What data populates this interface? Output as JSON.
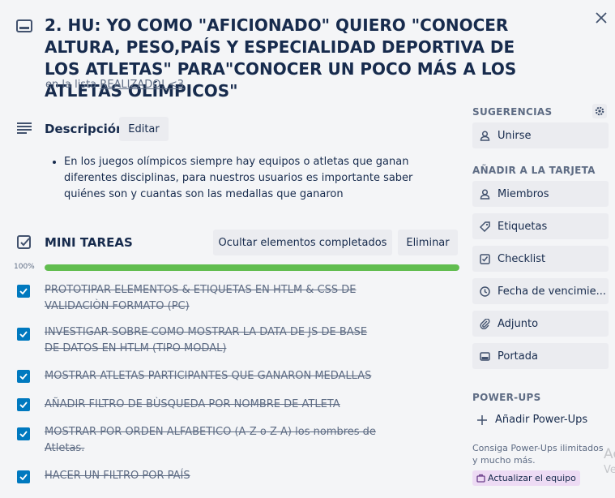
{
  "card": {
    "title": "2. HU: YO COMO \"AFICIONADO\" QUIERO \"CONOCER ALTURA, PESO,PAÍS Y ESPECIALIDAD DEPORTIVA DE LOS ATLETAS\" PARA\"CONOCER UN POCO MÁS A LOS ATLETAS OLÍMPICOS\"",
    "list_prefix": "en la lista",
    "list_name": "REALIZADO! <3"
  },
  "description": {
    "heading": "Descripción",
    "edit_label": "Editar",
    "bullets": [
      "En los juegos olímpicos siempre hay equipos o atletas que ganan diferentes disciplinas, para nuestros usuarios es importante saber quiénes son y cuantas son las medallas que ganaron"
    ]
  },
  "checklist": {
    "heading": "MINI TAREAS",
    "hide_label": "Ocultar elementos completados",
    "delete_label": "Eliminar",
    "progress_label": "100%",
    "progress": 1.0,
    "items": [
      {
        "text": "PROTOTIPAR ELEMENTOS & ETIQUETAS EN HTLM & CSS DE VALIDACIÒN FORMATO (PC)",
        "checked": true
      },
      {
        "text": "INVESTIGAR SOBRE COMO MOSTRAR LA DATA DE JS DE BASE DE DATOS EN HTLM (TIPO MODAL)",
        "checked": true
      },
      {
        "text": "MOSTRAR ATLETAS PARTICIPANTES QUE GANARON MEDALLAS",
        "checked": true
      },
      {
        "text": "AÑADIR FILTRO DE BÙSQUEDA POR NOMBRE DE ATLETA",
        "checked": true
      },
      {
        "text": "MOSTRAR POR ORDEN ALFABETICO (A-Z o Z-A) los nombres de Atletas.",
        "checked": true
      },
      {
        "text": "HACER UN FILTRO POR PAÍS",
        "checked": true
      }
    ]
  },
  "sidebar": {
    "suggestions_label": "SUGERENCIAS",
    "join_label": "Unirse",
    "add_label": "AÑADIR A LA TARJETA",
    "members_label": "Miembros",
    "labels_label": "Etiquetas",
    "checklist_label": "Checklist",
    "due_label": "Fecha de vencimie...",
    "attachment_label": "Adjunto",
    "cover_label": "Portada",
    "powerups_label": "POWER-UPS",
    "add_powerups_label": "Añadir Power-Ups",
    "powerups_note": "Consiga Power-Ups ilimitados y mucho más.",
    "upgrade_label": "Actualizar el equipo",
    "ghost_text_1": "Ac",
    "ghost_text_2": "Ve"
  },
  "colors": {
    "accent": "#0079bf",
    "progress": "#61bd4f",
    "upgrade_bg": "#eddbf4"
  }
}
